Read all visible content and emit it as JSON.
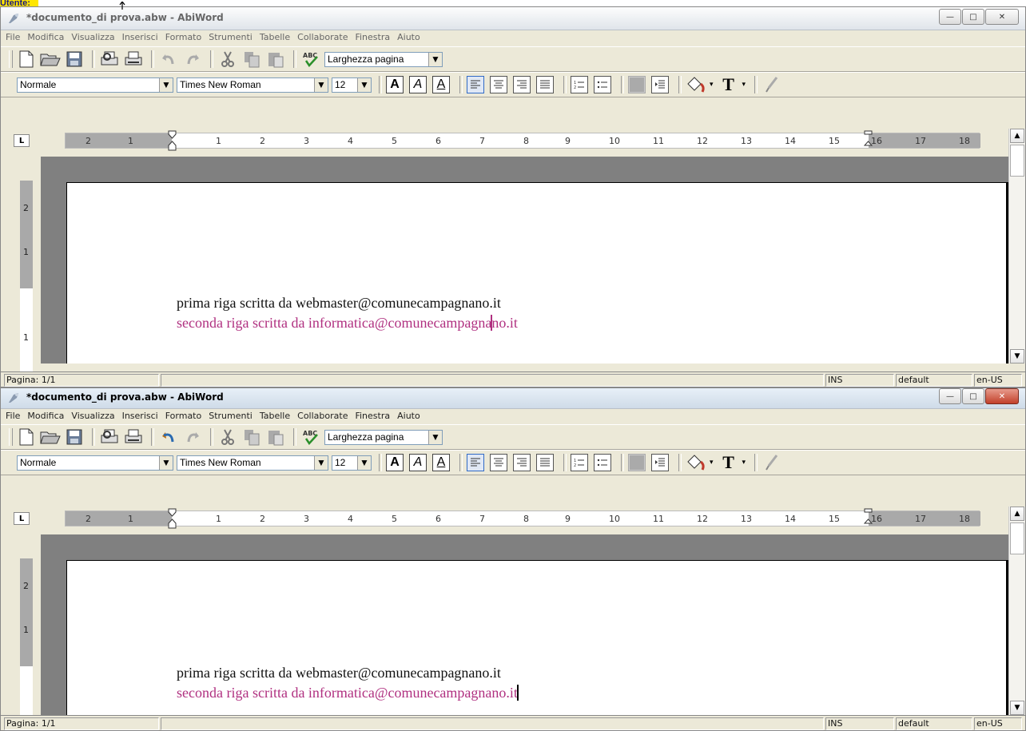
{
  "top_label": "Utente:",
  "windows": [
    {
      "title": "*documento_di prova.abw - AbiWord",
      "menu": [
        "File",
        "Modifica",
        "Visualizza",
        "Inserisci",
        "Formato",
        "Strumenti",
        "Tabelle",
        "Collaborate",
        "Finestra",
        "Aiuto"
      ],
      "zoom": "Larghezza pagina",
      "style": "Normale",
      "font": "Times New Roman",
      "size": "12",
      "line1": "prima riga scritta da webmaster@comunecampagnano.it",
      "line2_before": "seconda riga scritta da informatica@comunecampagna",
      "line2_after": "no.it",
      "status": {
        "page": "Pagina: 1/1",
        "mode": "INS",
        "style": "default",
        "lang": "en-US"
      },
      "caret_color": "#b03080"
    },
    {
      "title": "*documento_di prova.abw - AbiWord",
      "menu": [
        "File",
        "Modifica",
        "Visualizza",
        "Inserisci",
        "Formato",
        "Strumenti",
        "Tabelle",
        "Collaborate",
        "Finestra",
        "Aiuto"
      ],
      "zoom": "Larghezza pagina",
      "style": "Normale",
      "font": "Times New Roman",
      "size": "12",
      "line1": "prima riga scritta da webmaster@comunecampagnano.it",
      "line2_before": "seconda riga scritta da informatica@comunecampagnano.it",
      "line2_after": "",
      "status": {
        "page": "Pagina: 1/1",
        "mode": "INS",
        "style": "default",
        "lang": "en-US"
      },
      "caret_color": "#000000"
    }
  ],
  "ruler": {
    "numbers": [
      "2",
      "1",
      "1",
      "2",
      "3",
      "4",
      "5",
      "6",
      "7",
      "8",
      "9",
      "10",
      "11",
      "12",
      "13",
      "14",
      "15",
      "16",
      "17",
      "18"
    ],
    "vertical_numbers": [
      "2",
      "1",
      "1"
    ]
  },
  "icons": {
    "new": "new-document-icon",
    "open": "open-folder-icon",
    "save": "save-disk-icon",
    "print_preview": "print-preview-icon",
    "print": "printer-icon",
    "undo": "undo-arrow-icon",
    "redo": "redo-arrow-icon",
    "cut": "scissors-icon",
    "copy": "copy-icon",
    "paste": "paste-icon",
    "spell": "spellcheck-icon"
  }
}
